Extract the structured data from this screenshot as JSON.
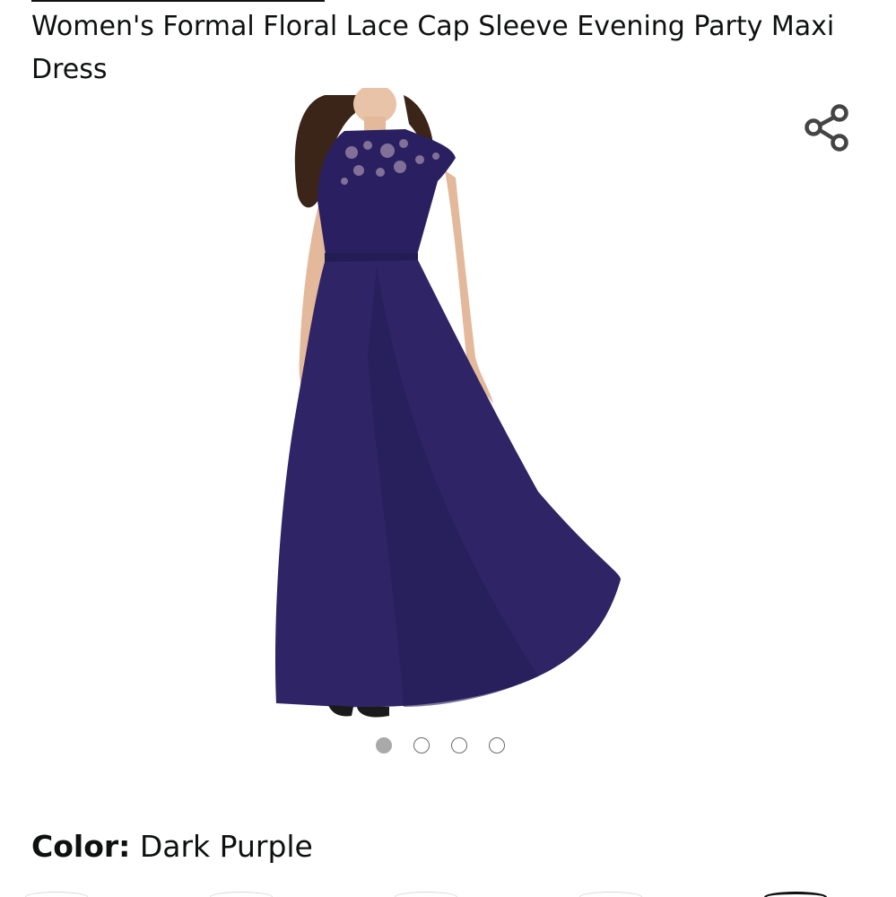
{
  "product": {
    "title": "Women's Formal Floral Lace Cap Sleeve Evening Party Maxi Dress"
  },
  "share": {
    "icon": "share-icon"
  },
  "gallery": {
    "image_alt": "Dark purple lace cap sleeve maxi dress",
    "dress_color": "#2e2466",
    "image_count": 4,
    "active_index": 0
  },
  "color_selector": {
    "label": "Color:",
    "value": "Dark Purple"
  },
  "colors": {
    "text": "#0f1111",
    "dot_active": "#a9a9a9",
    "dot_border": "#6b6b6b"
  }
}
